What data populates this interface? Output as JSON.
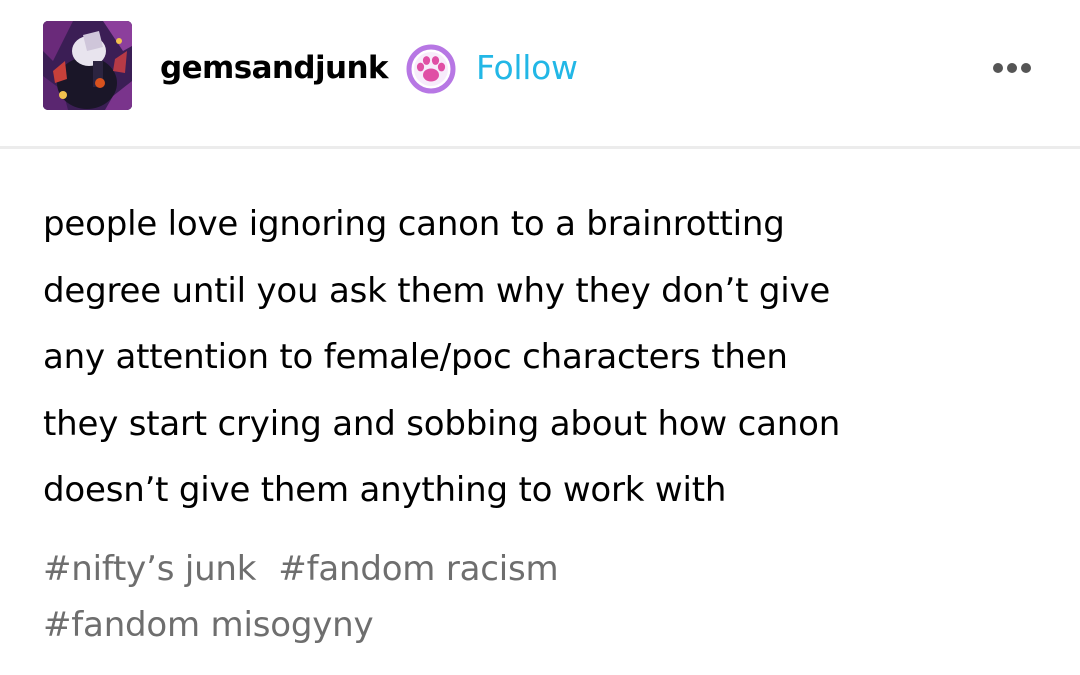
{
  "header": {
    "username": "gemsandjunk",
    "badge_icon": "paw-badge-icon",
    "follow_label": "Follow",
    "more_icon": "more-options-icon",
    "colors": {
      "follow": "#22b7e6",
      "badge_ring": "#b777e4",
      "badge_paw": "#e04fa5"
    }
  },
  "post": {
    "lines": [
      "people love ignoring canon to a brainrotting",
      "degree until you ask them why they don’t give",
      "any attention to female/poc characters then",
      "they start crying and sobbing about how canon",
      "doesn’t give them anything to work with"
    ]
  },
  "tags": {
    "rows": [
      [
        "#nifty’s junk",
        "#fandom racism"
      ],
      [
        "#fandom misogyny"
      ]
    ]
  }
}
